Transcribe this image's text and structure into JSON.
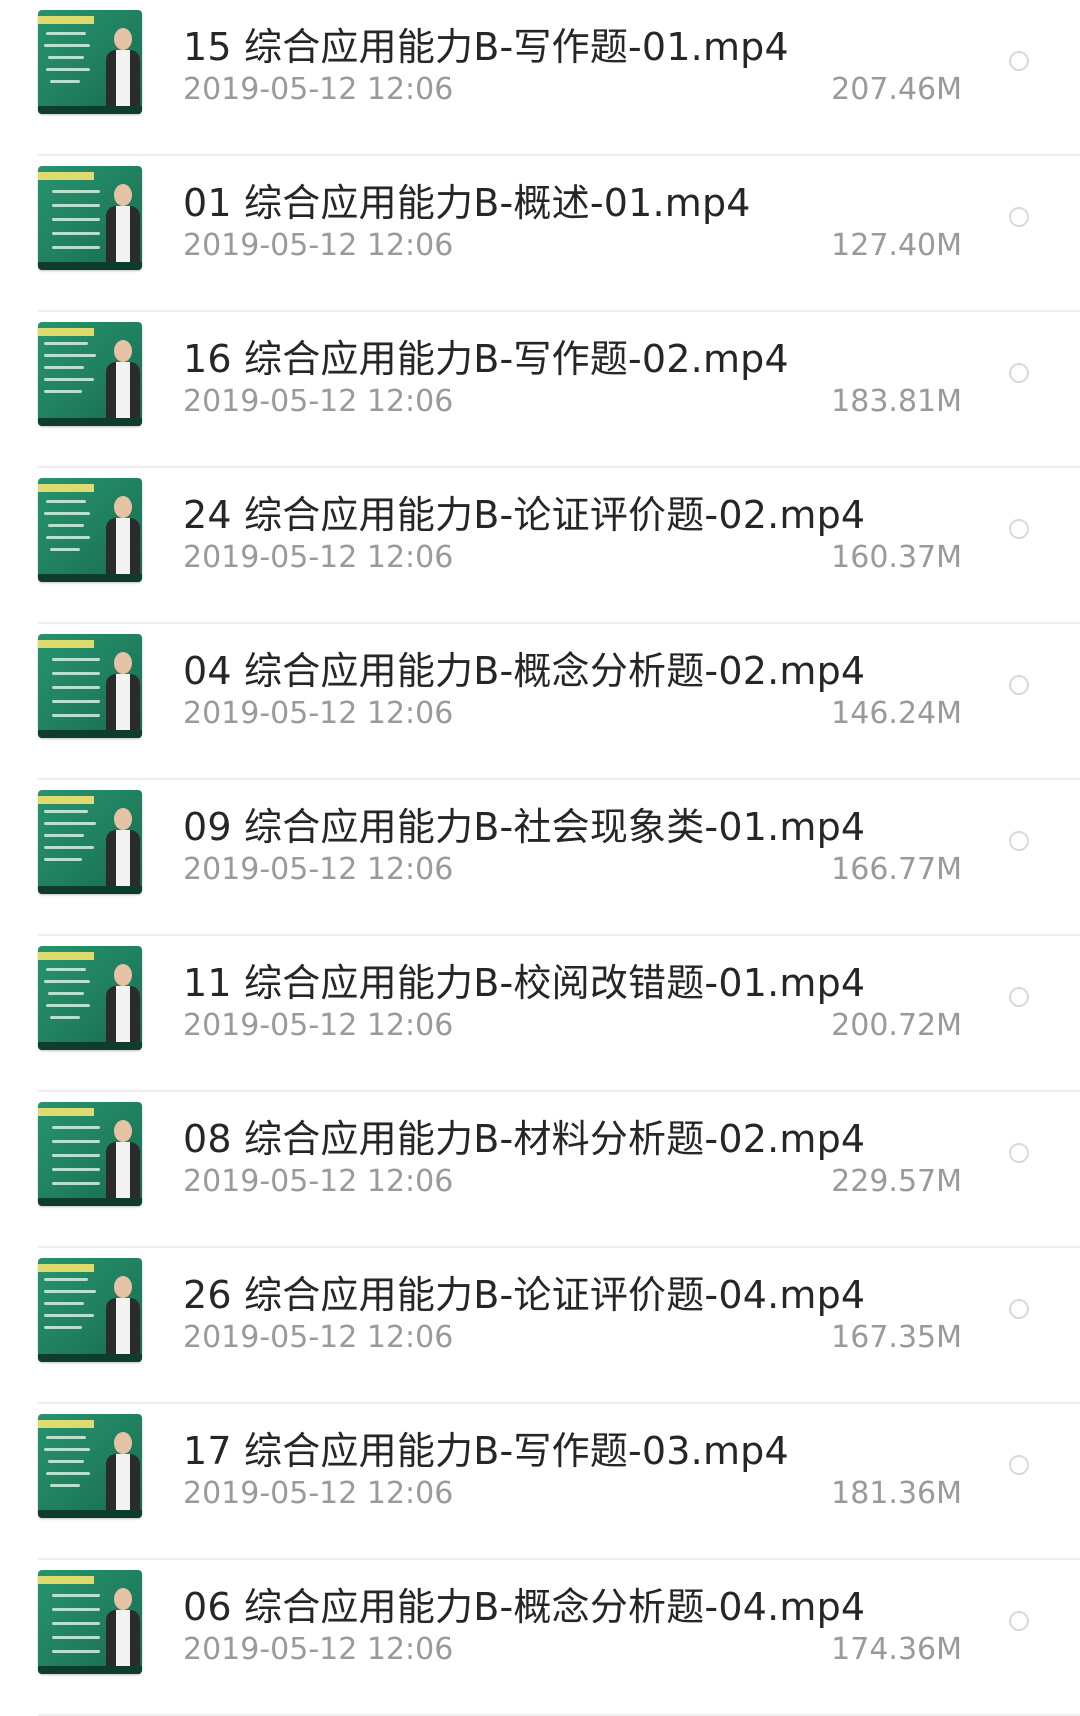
{
  "files": [
    {
      "name": "15 综合应用能力B-写作题-01.mp4",
      "date": "2019-05-12 12:06",
      "size": "207.46M",
      "thumbnail_icon": "video-thumbnail-icon"
    },
    {
      "name": "01 综合应用能力B-概述-01.mp4",
      "date": "2019-05-12 12:06",
      "size": "127.40M",
      "thumbnail_icon": "video-thumbnail-icon"
    },
    {
      "name": "16 综合应用能力B-写作题-02.mp4",
      "date": "2019-05-12 12:06",
      "size": "183.81M",
      "thumbnail_icon": "video-thumbnail-icon"
    },
    {
      "name": "24 综合应用能力B-论证评价题-02.mp4",
      "date": "2019-05-12 12:06",
      "size": "160.37M",
      "thumbnail_icon": "video-thumbnail-icon"
    },
    {
      "name": "04 综合应用能力B-概念分析题-02.mp4",
      "date": "2019-05-12 12:06",
      "size": "146.24M",
      "thumbnail_icon": "video-thumbnail-icon"
    },
    {
      "name": "09 综合应用能力B-社会现象类-01.mp4",
      "date": "2019-05-12 12:06",
      "size": "166.77M",
      "thumbnail_icon": "video-thumbnail-icon"
    },
    {
      "name": "11 综合应用能力B-校阅改错题-01.mp4",
      "date": "2019-05-12 12:06",
      "size": "200.72M",
      "thumbnail_icon": "video-thumbnail-icon"
    },
    {
      "name": "08 综合应用能力B-材料分析题-02.mp4",
      "date": "2019-05-12 12:06",
      "size": "229.57M",
      "thumbnail_icon": "video-thumbnail-icon"
    },
    {
      "name": "26 综合应用能力B-论证评价题-04.mp4",
      "date": "2019-05-12 12:06",
      "size": "167.35M",
      "thumbnail_icon": "video-thumbnail-icon"
    },
    {
      "name": "17 综合应用能力B-写作题-03.mp4",
      "date": "2019-05-12 12:06",
      "size": "181.36M",
      "thumbnail_icon": "video-thumbnail-icon"
    },
    {
      "name": "06 综合应用能力B-概念分析题-04.mp4",
      "date": "2019-05-12 12:06",
      "size": "174.36M",
      "thumbnail_icon": "video-thumbnail-icon"
    }
  ],
  "colors": {
    "title_text": "#262626",
    "meta_text": "#9a9a9a",
    "divider": "#eeeeee",
    "radio_border": "#d9d9d9",
    "thumbnail_green": "#1f7f5e"
  }
}
